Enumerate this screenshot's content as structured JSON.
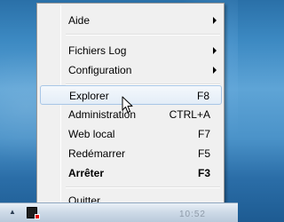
{
  "menu": {
    "items": [
      {
        "label": "Aide",
        "shortcut": "",
        "submenu": true
      },
      {
        "label": "Fichiers Log",
        "shortcut": "",
        "submenu": true
      },
      {
        "label": "Configuration",
        "shortcut": "",
        "submenu": true
      },
      {
        "label": "Explorer",
        "shortcut": "F8",
        "submenu": false,
        "highlighted": true
      },
      {
        "label": "Administration",
        "shortcut": "CTRL+A",
        "submenu": false
      },
      {
        "label": "Web local",
        "shortcut": "F7",
        "submenu": false
      },
      {
        "label": "Redémarrer",
        "shortcut": "F5",
        "submenu": false
      },
      {
        "label": "Arrêter",
        "shortcut": "F3",
        "submenu": false,
        "bold": true
      },
      {
        "label": "Quitter",
        "shortcut": "",
        "submenu": false
      }
    ]
  },
  "taskbar": {
    "show_hidden_icon": "chevron-up-icon",
    "clock_partial": "10:52"
  },
  "colors": {
    "menu_bg": "#f0f0f0",
    "highlight_border": "#a8c6e6",
    "tray_icon_accent": "#e00000"
  }
}
